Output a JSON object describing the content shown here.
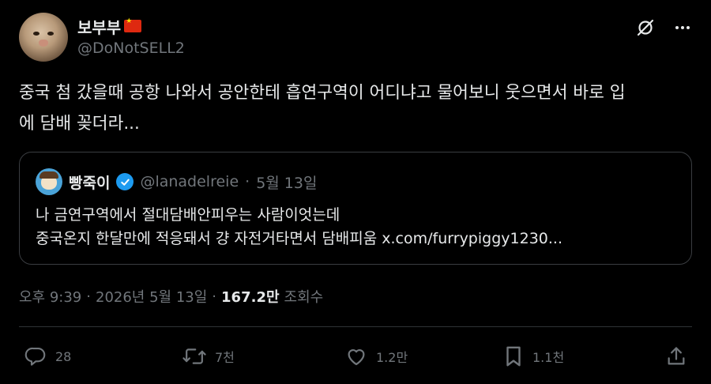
{
  "author": {
    "display_name": "보부부",
    "handle": "@DoNotSELL2"
  },
  "icons": {
    "grok": "grok-icon",
    "more": "more-icon",
    "reply": "reply-icon",
    "repost": "repost-icon",
    "like": "like-icon",
    "bookmark": "bookmark-icon",
    "share": "share-icon",
    "verified": "verified-badge-icon",
    "flag": "china-flag-icon"
  },
  "tweet": {
    "line1": "중국 첨 갔을때 공항 나와서 공안한테 흡연구역이 어디냐고 물어보니 웃으면서 바로 입",
    "line2": "에 담배 꽂더라..."
  },
  "quote": {
    "display_name": "빵죽이",
    "handle": "@lanadelreie",
    "separator": "·",
    "date": "5월 13일",
    "line1": "나 금연구역에서 절대담배안피우는 사람이엇는데",
    "line2": "중국온지 한달만에 적응돼서 걍 자전거타면서 담배피움 x.com/furrypiggy1230..."
  },
  "meta": {
    "time": "오후 9:39",
    "sep1": "·",
    "date": "2026년 5월 13일",
    "sep2": "·",
    "views": "167.2만",
    "views_label": "조회수"
  },
  "actions": {
    "replies": "28",
    "reposts": "7천",
    "likes": "1.2만",
    "bookmarks": "1.1천"
  },
  "colors": {
    "background": "#000000",
    "text": "#e7e9ea",
    "muted": "#71767b",
    "border": "#2f3336",
    "verified": "#1d9bf0"
  }
}
